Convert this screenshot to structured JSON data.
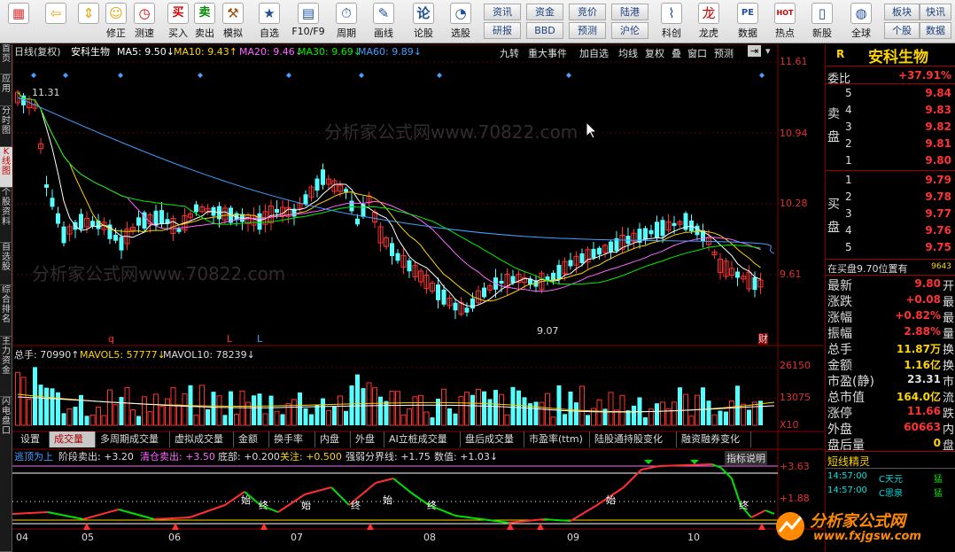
{
  "toolbar": {
    "buttons": [
      {
        "label": "",
        "icon": "grid-icon",
        "glyph": "▦"
      },
      {
        "label": "",
        "icon": "back-arrow-icon",
        "glyph": "⇦"
      },
      {
        "label": "",
        "icon": "updown-arrow-icon",
        "glyph": "⇕"
      },
      {
        "label": "修正",
        "icon": "smiley-icon",
        "glyph": "☺"
      },
      {
        "label": "测速",
        "icon": "clock-icon",
        "glyph": "◷"
      },
      {
        "label": "买入",
        "icon": "buy-icon",
        "glyph": "买"
      },
      {
        "label": "卖出",
        "icon": "sell-icon",
        "glyph": "卖"
      },
      {
        "label": "模拟",
        "icon": "hammer-icon",
        "glyph": "⚒"
      },
      {
        "label": "自选",
        "icon": "star-icon",
        "glyph": "★"
      },
      {
        "label": "F10/F9",
        "icon": "f10-icon",
        "glyph": "▤"
      },
      {
        "label": "周期",
        "icon": "period-icon",
        "glyph": "⏱"
      },
      {
        "label": "画线",
        "icon": "pencil-icon",
        "glyph": "✎"
      },
      {
        "label": "论股",
        "icon": "discuss-icon",
        "glyph": "论"
      },
      {
        "label": "选股",
        "icon": "stock-select-icon",
        "glyph": "◔"
      },
      {
        "label": "科创",
        "icon": "kechuang-icon",
        "glyph": "⌇"
      },
      {
        "label": "龙虎",
        "icon": "dragon-icon",
        "glyph": "龙"
      },
      {
        "label": "数据",
        "icon": "pe-icon",
        "glyph": "PE"
      },
      {
        "label": "热点",
        "icon": "hot-icon",
        "glyph": "HOT"
      },
      {
        "label": "新股",
        "icon": "newstock-icon",
        "glyph": "▯"
      },
      {
        "label": "全球",
        "icon": "globe-icon",
        "glyph": "◍"
      }
    ],
    "small": [
      "资讯",
      "资金",
      "竞价",
      "陆港",
      "研报",
      "BBD",
      "预测",
      "沪伦",
      "板块",
      "快讯",
      "个股",
      "数据"
    ]
  },
  "left_tabs": [
    "首页",
    "应用",
    "分时图",
    "K线图",
    "个股资料",
    "自选股",
    "综合排名",
    "主力资金",
    "闪电盘口"
  ],
  "header": {
    "period": "日线(复权)",
    "name": "安科生物",
    "ma": [
      {
        "label": "MA5: 9.50↓",
        "color": "#ffffff"
      },
      {
        "label": "MA10: 9.43↑",
        "color": "#ffd400"
      },
      {
        "label": "MA20: 9.46↓",
        "color": "#ff66ff"
      },
      {
        "label": "MA30: 9.69↓",
        "color": "#00ee00"
      },
      {
        "label": "MA60: 9.89↓",
        "color": "#40a0ff"
      }
    ],
    "buttons": [
      "九转",
      "重大事件",
      "加自选",
      "均线",
      "复权",
      "叠",
      "窗口",
      "预测"
    ]
  },
  "price_axis": [
    "11.61",
    "10.94",
    "10.28",
    "9.61"
  ],
  "annotations": {
    "high": "11.31",
    "low": "9.07",
    "q": "q",
    "l1": "L",
    "l2": "L",
    "cai": "财"
  },
  "volume": {
    "title": "总手: 70990↑",
    "mav5": "MAVOL5: 57777↓",
    "mav10": "MAVOL10: 78239↓",
    "axis": [
      "26150",
      "13075",
      "X10"
    ]
  },
  "indicator_tabs": [
    "设置",
    "成交量",
    "多周期成交量",
    "虚拟成交量",
    "金额",
    "换手率",
    "内盘",
    "外盘",
    "AI立桩成交量",
    "盘后成交量",
    "市盈率(ttm)",
    "陆股通持股变化",
    "融资融券变化"
  ],
  "signal": {
    "name": "逃顶为上",
    "stage": "阶段卖出: +3.20",
    "clear": "清仓卖出: +3.50",
    "bottom": "底部: +0.200",
    "watch": "关注: +0.500",
    "strong": "强弱分界线: +1.75",
    "value": "数值: +1.03↓",
    "explain": "指标说明",
    "axis": [
      "+3.63",
      "+1.88"
    ],
    "labels": [
      "始",
      "终",
      "始",
      "终",
      "始",
      "终",
      "始",
      "终"
    ]
  },
  "dates": [
    "04",
    "05",
    "06",
    "07",
    "08",
    "09",
    "10"
  ],
  "watermarks": [
    "分析家公式网www.70822.com",
    "分析家公式网www.70822.com"
  ],
  "right_panel": {
    "flag": "R",
    "name": "安科生物",
    "weibi_label": "委比",
    "weibi": "+37.91%",
    "sell_label": "卖盘",
    "sell": [
      {
        "n": "5",
        "p": "9.84"
      },
      {
        "n": "4",
        "p": "9.83"
      },
      {
        "n": "3",
        "p": "9.82"
      },
      {
        "n": "2",
        "p": "9.81"
      },
      {
        "n": "1",
        "p": "9.80"
      }
    ],
    "buy_label": "买盘",
    "buy": [
      {
        "n": "1",
        "p": "9.79"
      },
      {
        "n": "2",
        "p": "9.78"
      },
      {
        "n": "3",
        "p": "9.77"
      },
      {
        "n": "4",
        "p": "9.76"
      },
      {
        "n": "5",
        "p": "9.75"
      }
    ],
    "queue": "在买盘9.70位置有",
    "queue_num": "9643",
    "stats": [
      {
        "l": "最新",
        "v": "9.80",
        "s": "开"
      },
      {
        "l": "涨跌",
        "v": "+0.08",
        "s": "最"
      },
      {
        "l": "涨幅",
        "v": "+0.82%",
        "s": "最"
      },
      {
        "l": "振幅",
        "v": "2.88%",
        "s": "量"
      },
      {
        "l": "总手",
        "v": "11.87万",
        "s": "换"
      },
      {
        "l": "金额",
        "v": "1.16亿",
        "s": "换"
      },
      {
        "l": "市盈(静)",
        "v": "23.31",
        "s": "市"
      },
      {
        "l": "总市值",
        "v": "164.0亿",
        "s": "流"
      },
      {
        "l": "涨停",
        "v": "11.66",
        "s": "跌"
      },
      {
        "l": "外盘",
        "v": "60663",
        "s": "内"
      },
      {
        "l": "盘后量",
        "v": "0",
        "s": "盘"
      }
    ],
    "short_title": "短线精灵",
    "short": [
      {
        "t": "14:57:00",
        "n": "C天元",
        "a": "猛"
      },
      {
        "t": "14:57:00",
        "n": "C思泉",
        "a": "猛"
      }
    ]
  },
  "logo": {
    "main": "分析家公式网",
    "url": "www.fxjgsw.com"
  }
}
